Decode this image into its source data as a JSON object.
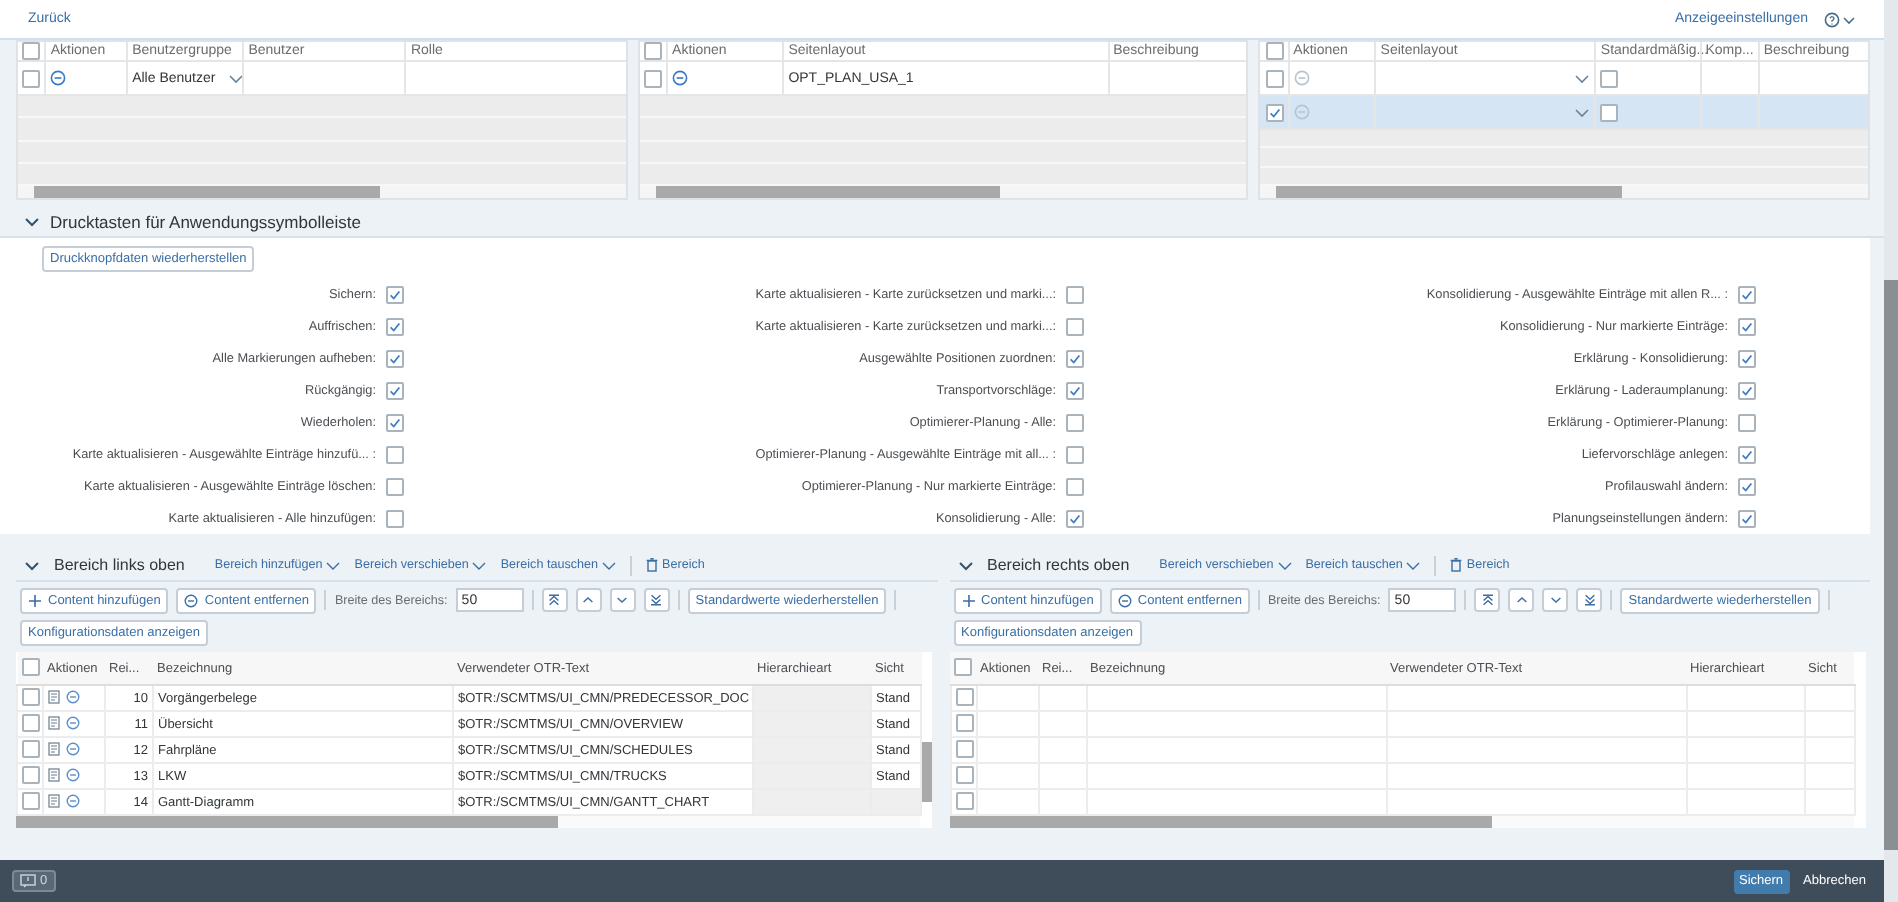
{
  "header": {
    "back_link": "Zurück",
    "settings_link": "Anzeigeeinstellungen"
  },
  "top_tables": [
    {
      "all_checked": false,
      "columns": [
        "Aktionen",
        "Benutzergruppe",
        "Benutzer",
        "Rolle"
      ],
      "rows": [
        {
          "checked": false,
          "selected": false,
          "cells": [
            {
              "kind": "action",
              "disabled": false
            },
            {
              "kind": "dropdown",
              "value": "Alle Benutzer"
            },
            {
              "kind": "empty"
            },
            {
              "kind": "empty"
            }
          ]
        }
      ]
    },
    {
      "all_checked": false,
      "columns": [
        "Aktionen",
        "Seitenlayout",
        "Beschreibung"
      ],
      "rows": [
        {
          "checked": false,
          "selected": false,
          "cells": [
            {
              "kind": "action",
              "disabled": false
            },
            {
              "kind": "input",
              "value": "OPT_PLAN_USA_1"
            },
            {
              "kind": "empty"
            }
          ]
        }
      ]
    },
    {
      "all_checked": false,
      "columns": [
        "Aktionen",
        "Seitenlayout",
        "Standardmäßig...",
        "Komp...",
        "Beschreibung"
      ],
      "rows": [
        {
          "checked": false,
          "selected": false,
          "cells": [
            {
              "kind": "action",
              "disabled": true
            },
            {
              "kind": "dropdown"
            },
            {
              "kind": "checkbox",
              "checked": false
            },
            {
              "kind": "empty"
            },
            {
              "kind": "empty"
            }
          ]
        },
        {
          "checked": true,
          "selected": true,
          "cells": [
            {
              "kind": "action",
              "disabled": true
            },
            {
              "kind": "dropdown"
            },
            {
              "kind": "checkbox",
              "checked": false
            },
            {
              "kind": "empty"
            },
            {
              "kind": "empty"
            }
          ]
        }
      ]
    }
  ],
  "section": {
    "title": "Drucktasten für Anwendungssymbolleiste",
    "expanded": true,
    "restore_button": "Druckknopfdaten wiederherstellen",
    "columns": [
      [
        {
          "label": "Sichern:",
          "checked": true
        },
        {
          "label": "Auffrischen:",
          "checked": true
        },
        {
          "label": "Alle Markierungen aufheben:",
          "checked": true
        },
        {
          "label": "Rückgängig:",
          "checked": true
        },
        {
          "label": "Wiederholen:",
          "checked": true
        },
        {
          "label": "Karte aktualisieren - Ausgewählte Einträge hinzufü... :",
          "checked": false
        },
        {
          "label": "Karte aktualisieren - Ausgewählte Einträge löschen:",
          "checked": false
        },
        {
          "label": "Karte aktualisieren - Alle hinzufügen:",
          "checked": false
        }
      ],
      [
        {
          "label": "Karte aktualisieren - Karte zurücksetzen und marki...:",
          "checked": false
        },
        {
          "label": "Karte aktualisieren - Karte zurücksetzen und marki...:",
          "checked": false
        },
        {
          "label": "Ausgewählte Positionen zuordnen:",
          "checked": true
        },
        {
          "label": "Transportvorschläge:",
          "checked": true
        },
        {
          "label": "Optimierer-Planung - Alle:",
          "checked": false
        },
        {
          "label": "Optimierer-Planung - Ausgewählte Einträge mit all... :",
          "checked": false
        },
        {
          "label": "Optimierer-Planung - Nur markierte Einträge:",
          "checked": false
        },
        {
          "label": "Konsolidierung - Alle:",
          "checked": true
        }
      ],
      [
        {
          "label": "Konsolidierung - Ausgewählte Einträge mit allen R... :",
          "checked": true
        },
        {
          "label": "Konsolidierung - Nur markierte Einträge:",
          "checked": true
        },
        {
          "label": "Erklärung - Konsolidierung:",
          "checked": true
        },
        {
          "label": "Erklärung - Laderaumplanung:",
          "checked": true
        },
        {
          "label": "Erklärung - Optimierer-Planung:",
          "checked": false
        },
        {
          "label": "Liefervorschläge anlegen:",
          "checked": true
        },
        {
          "label": "Profilauswahl ändern:",
          "checked": true
        },
        {
          "label": "Planungseinstellungen ändern:",
          "checked": true
        }
      ]
    ]
  },
  "areas": [
    {
      "title": "Bereich links oben",
      "expanded": true,
      "all_checked": false,
      "menus": [
        "Bereich hinzufügen",
        "Bereich verschieben",
        "Bereich tauschen"
      ],
      "delete_button": "Bereich",
      "add_button": "Content hinzufügen",
      "remove_button": "Content entfernen",
      "width_label": "Breite des Bereichs:",
      "width_value": "50",
      "defaults_button": "Standardwerte wiederherstellen",
      "config_button": "Konfigurationsdaten anzeigen",
      "columns": [
        "Aktionen",
        "Rei...",
        "Bezeichnung",
        "Verwendeter OTR-Text",
        "Hierarchieart",
        "Sicht"
      ],
      "rows": [
        {
          "checked": false,
          "number": "10",
          "name": "Vorgängerbelege",
          "otr": "$OTR:/SCMTMS/UI_CMN/PREDECESSOR_DOC",
          "view": "Stand"
        },
        {
          "checked": false,
          "number": "11",
          "name": "Übersicht",
          "otr": "$OTR:/SCMTMS/UI_CMN/OVERVIEW",
          "view": "Stand"
        },
        {
          "checked": false,
          "number": "12",
          "name": "Fahrpläne",
          "otr": "$OTR:/SCMTMS/UI_CMN/SCHEDULES",
          "view": "Stand"
        },
        {
          "checked": false,
          "number": "13",
          "name": "LKW",
          "otr": "$OTR:/SCMTMS/UI_CMN/TRUCKS",
          "view": "Stand"
        },
        {
          "checked": false,
          "number": "14",
          "name": "Gantt-Diagramm",
          "otr": "$OTR:/SCMTMS/UI_CMN/GANTT_CHART"
        }
      ]
    },
    {
      "title": "Bereich rechts oben",
      "expanded": true,
      "all_checked": false,
      "menus": [
        "Bereich verschieben",
        "Bereich tauschen"
      ],
      "delete_button": "Bereich",
      "add_button": "Content hinzufügen",
      "remove_button": "Content entfernen",
      "width_label": "Breite des Bereichs:",
      "width_value": "50",
      "defaults_button": "Standardwerte wiederherstellen",
      "config_button": "Konfigurationsdaten anzeigen",
      "columns": [
        "Aktionen",
        "Rei...",
        "Bezeichnung",
        "Verwendeter OTR-Text",
        "Hierarchieart",
        "Sicht"
      ],
      "rows": [
        {
          "checked": false
        },
        {
          "checked": false
        },
        {
          "checked": false
        },
        {
          "checked": false
        },
        {
          "checked": false
        }
      ]
    }
  ],
  "footer": {
    "message_count": "0",
    "save_button": "Sichern",
    "cancel_button": "Abbrechen"
  }
}
